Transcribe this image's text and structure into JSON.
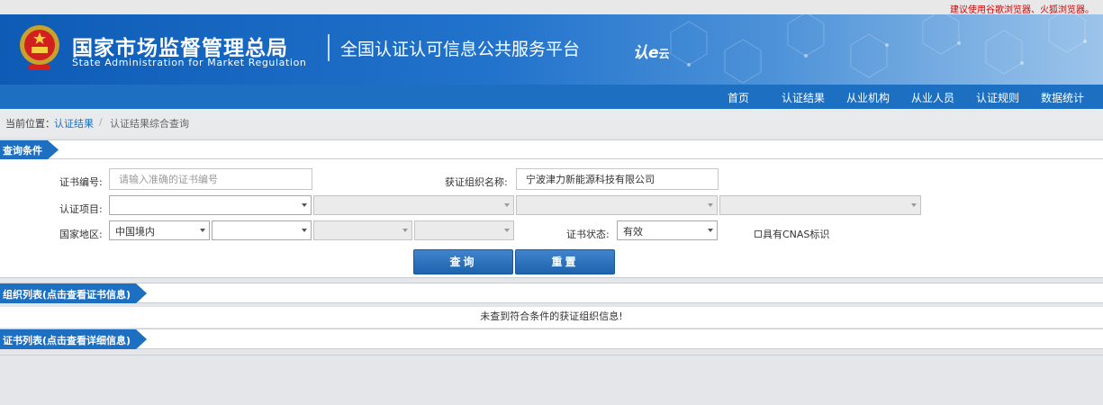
{
  "browser_tip": "建议使用谷歌浏览器、火狐浏览器。",
  "header": {
    "title_cn": "国家市场监督管理总局",
    "title_en": "State Administration for Market Regulation",
    "platform": "全国认证认可信息公共服务平台",
    "logo_main": "认e",
    "logo_sub": "云"
  },
  "nav": [
    "首页",
    "认证结果",
    "从业机构",
    "从业人员",
    "认证规则",
    "数据统计"
  ],
  "breadcrumb": {
    "label": "当前位置：",
    "link": "认证结果",
    "sep": "/",
    "current": "认证结果综合查询"
  },
  "query": {
    "section_title": "查询条件",
    "cert_no_label": "证书编号:",
    "cert_no_placeholder": "请输入准确的证书编号",
    "org_label": "获证组织名称:",
    "org_value": "宁波津力新能源科技有限公司",
    "project_label": "认证项目:",
    "region_label": "国家地区:",
    "region_value": "中国境内",
    "status_label": "证书状态:",
    "status_value": "有效",
    "cnas_label": "具有CNAS标识",
    "search_btn": "查询",
    "reset_btn": "重置"
  },
  "org_list": {
    "title": "组织列表(点击查看证书信息)",
    "empty": "未查到符合条件的获证组织信息!"
  },
  "cert_list": {
    "title": "证书列表(点击查看详细信息)"
  },
  "colors": {
    "nav_blue": "#1c6fc1",
    "tip_red": "#d40000"
  }
}
